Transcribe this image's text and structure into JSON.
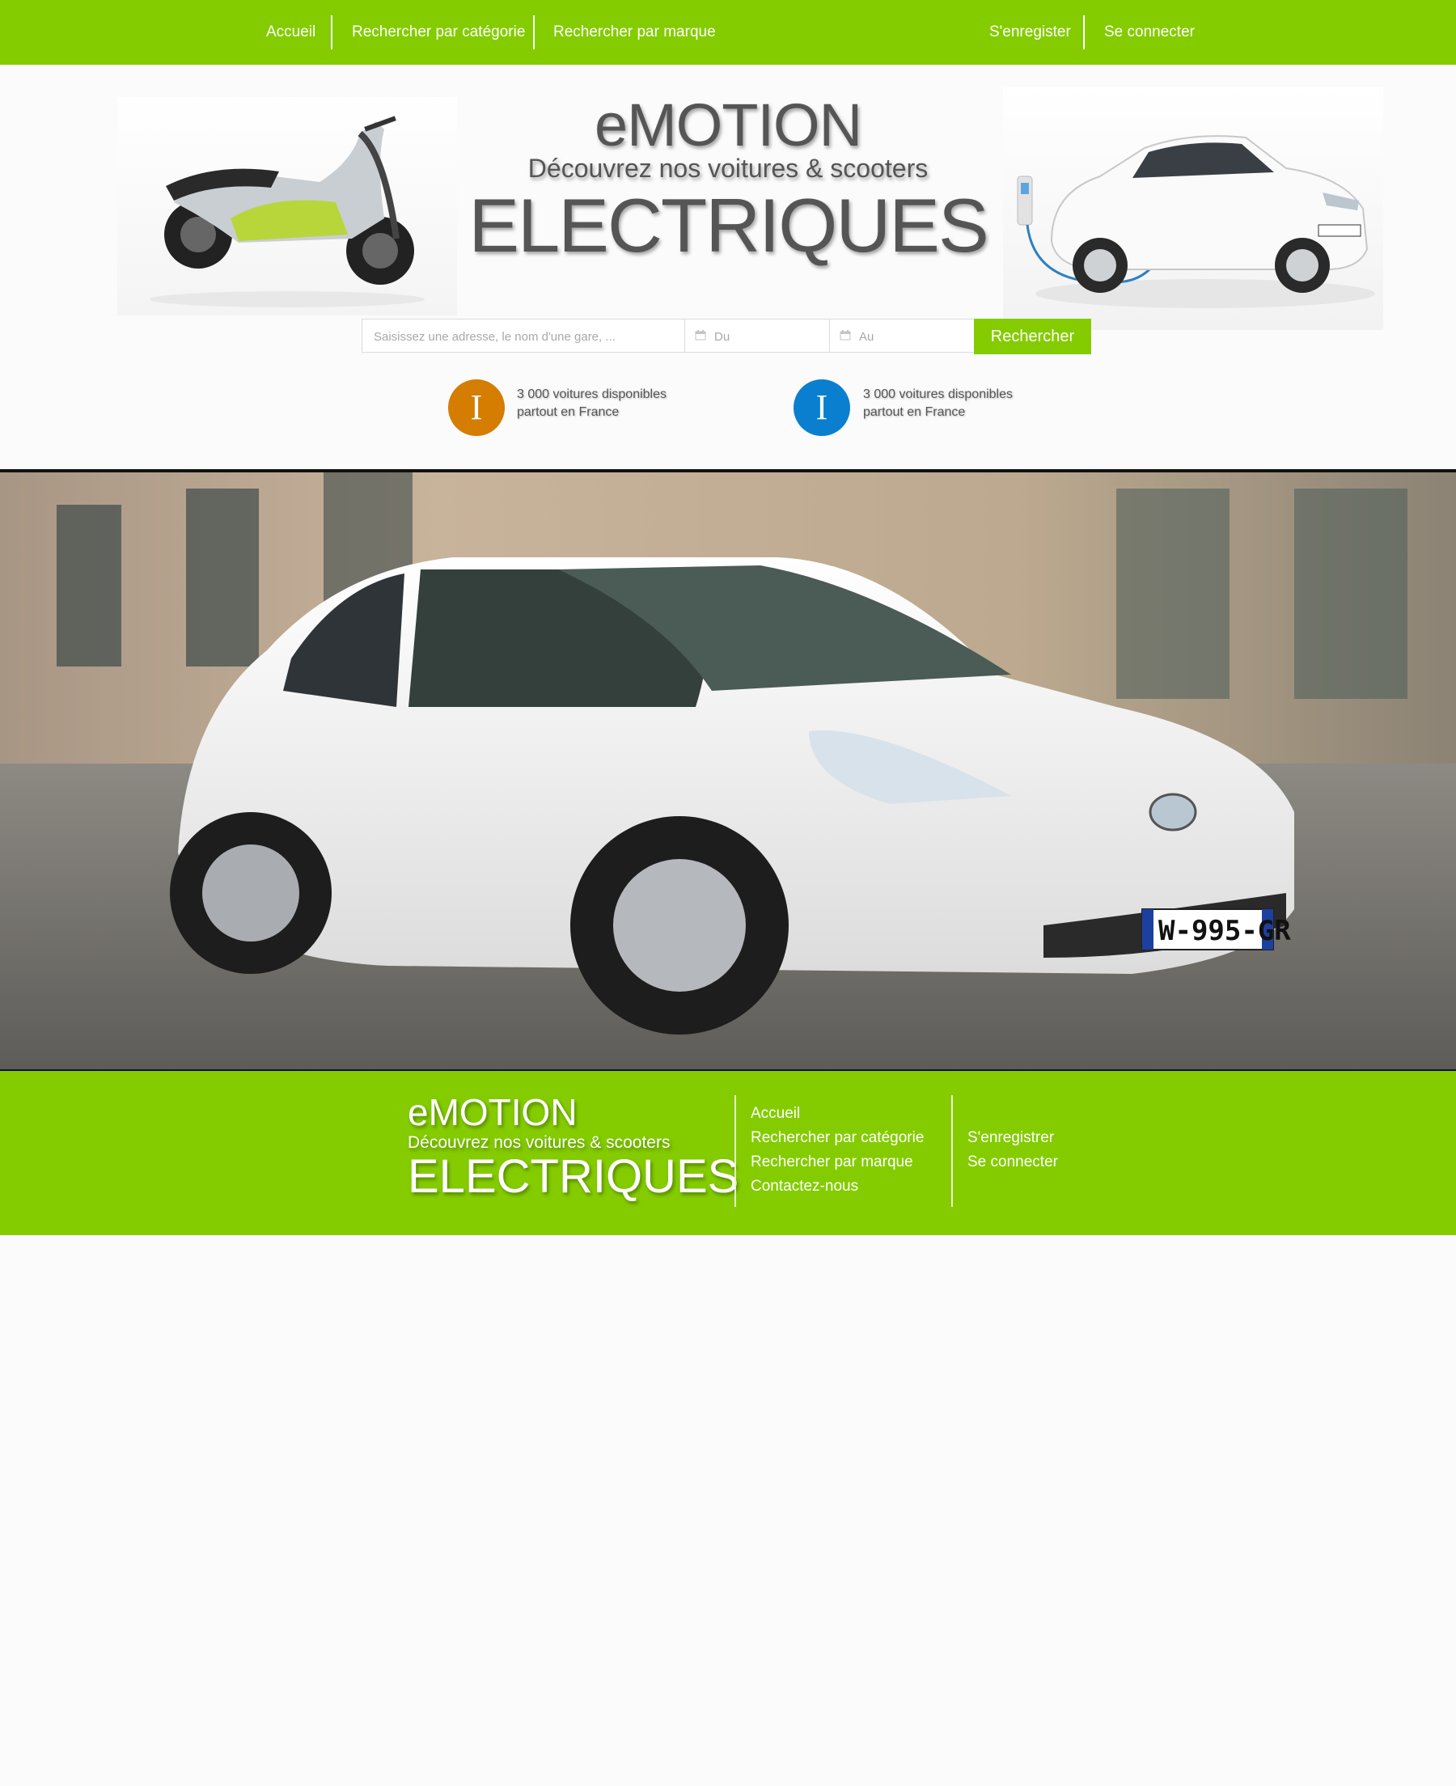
{
  "nav": {
    "home": "Accueil",
    "by_category": "Rechercher par catégorie",
    "by_brand": "Rechercher par marque",
    "register": "S'enregister",
    "login": "Se connecter"
  },
  "hero": {
    "brand_line1": "eMOTION",
    "brand_line2": "Découvrez nos voitures & scooters",
    "brand_line3": "ELECTRIQUES",
    "left_image": "electric-scooter-image",
    "right_image": "electric-car-charging-image"
  },
  "search": {
    "address_placeholder": "Saisissez une adresse, le nom d'une gare, ...",
    "from_placeholder": "Du",
    "to_placeholder": "Au",
    "button": "Rechercher"
  },
  "badges": [
    {
      "glyph": "I",
      "color": "#d57d00",
      "line1": "3 000 voitures disponibles",
      "line2": "partout en France"
    },
    {
      "glyph": "I",
      "color": "#0a7fd0",
      "line1": "3 000 voitures disponibles",
      "line2": "partout en France"
    }
  ],
  "banner": {
    "image": "white-electric-car-photo",
    "plate": "W-995-GR"
  },
  "footer": {
    "brand_line1": "eMOTION",
    "brand_line2": "Découvrez nos voitures & scooters",
    "brand_line3": "ELECTRIQUES",
    "links": [
      "Accueil",
      "Rechercher par catégorie",
      "Rechercher par marque",
      "Contactez-nous"
    ],
    "account_links": [
      "S'enregistrer",
      "Se connecter"
    ]
  },
  "colors": {
    "accent": "#84cc00",
    "text_gray": "#555555",
    "badge_orange": "#d57d00",
    "badge_blue": "#0a7fd0"
  }
}
